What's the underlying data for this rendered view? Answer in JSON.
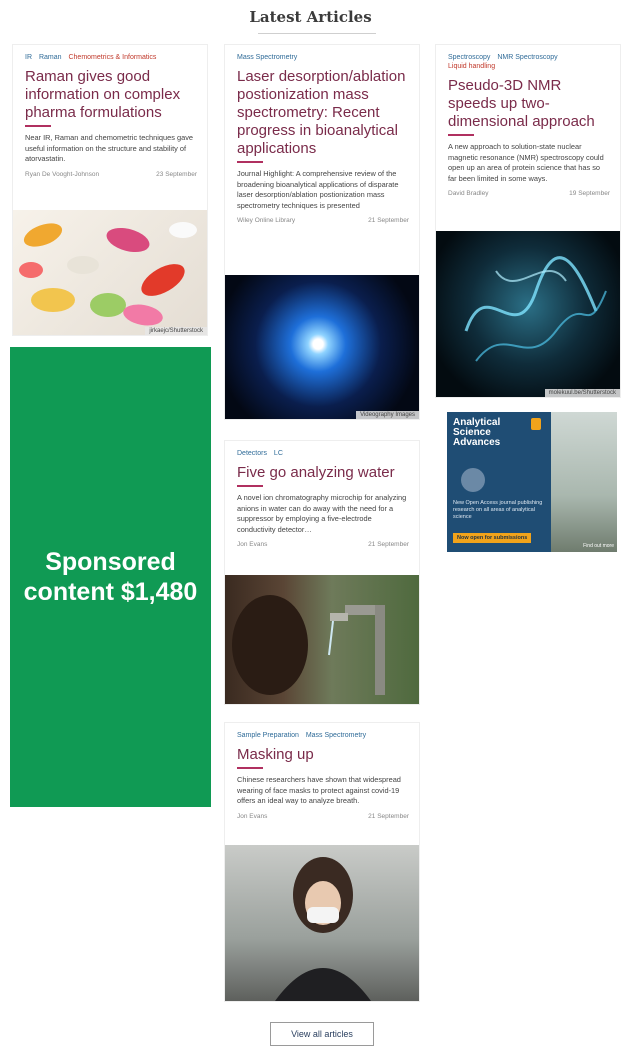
{
  "section_title": "Latest Articles",
  "articles": [
    {
      "tags": [
        "IR",
        "Raman",
        "Chemometrics & Informatics"
      ],
      "title": "Raman gives good information on complex pharma formulations",
      "excerpt": "Near IR, Raman and chemometric techniques gave useful information on the structure and stability of atorvastatin.",
      "author": "Ryan De Vooght-Johnson",
      "date": "23 September",
      "image_credit": "jirkaejc/Shutterstock"
    },
    {
      "tags": [
        "Mass Spectrometry"
      ],
      "title": "Laser desorption/ablation postionization mass spectrometry: Recent progress in bioanalytical applications",
      "excerpt": "Journal Highlight: A comprehensive review of the broadening bioanalytical applications of disparate laser desorption/ablation postionization mass spectrometry techniques is presented",
      "author": "Wiley Online Library",
      "date": "21 September",
      "image_credit": "Videography Images"
    },
    {
      "tags": [
        "Spectroscopy",
        "NMR Spectroscopy",
        "Liquid handling"
      ],
      "title": "Pseudo-3D NMR speeds up two-dimensional approach",
      "excerpt": "A new approach to solution-state nuclear magnetic resonance (NMR) spectroscopy could open up an area of protein science that has so far been limited in some ways.",
      "author": "David Bradley",
      "date": "19 September",
      "image_credit": "molekuul.be/Shutterstock"
    },
    {
      "tags": [
        "Detectors",
        "LC"
      ],
      "title": "Five go analyzing water",
      "excerpt": "A novel ion chromatography microchip for analyzing anions in water can do away with the need for a suppressor by employing a five-electrode conductivity detector…",
      "author": "Jon Evans",
      "date": "21 September"
    },
    {
      "tags": [
        "Sample Preparation",
        "Mass Spectrometry"
      ],
      "title": "Masking up",
      "excerpt": "Chinese researchers have shown that widespread wearing of face masks to protect against covid-19 offers an ideal way to analyze breath.",
      "author": "Jon Evans",
      "date": "21 September"
    }
  ],
  "sponsored": {
    "label": "Sponsored content $1,480"
  },
  "ad": {
    "title": "Analytical Science Advances",
    "text": "New Open Access journal publishing research on all areas of analytical science",
    "button": "Now open for submissions",
    "small": "Find out more"
  },
  "view_all_label": "View all articles",
  "colors": {
    "sponsored_bg": "#109a54",
    "title": "#7a2b4a",
    "tag": "#2f6b98"
  }
}
